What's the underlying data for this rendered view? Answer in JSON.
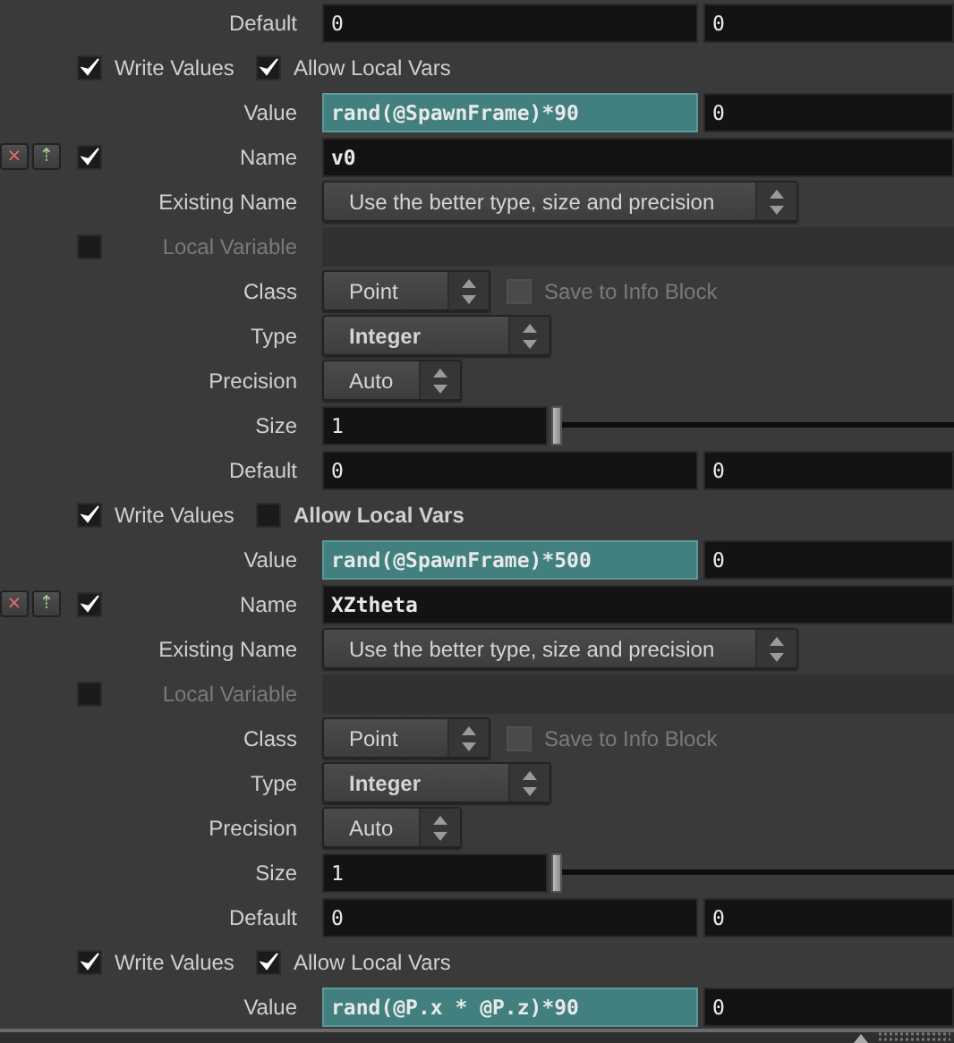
{
  "rows": [
    {
      "kind": "vector",
      "label": "Default",
      "expression": false,
      "values": [
        "0",
        "0"
      ]
    },
    {
      "kind": "checks",
      "items": [
        {
          "label": "Write Values",
          "checked": true,
          "modified": false
        },
        {
          "label": "Allow Local Vars",
          "checked": true,
          "modified": false
        }
      ]
    },
    {
      "kind": "vector",
      "label": "Value",
      "expression": true,
      "values": [
        "rand(@SpawnFrame)*90",
        "0"
      ]
    },
    {
      "kind": "name",
      "label": "Name",
      "enabled": true,
      "value": "v0",
      "remove": "×",
      "move": "⇡"
    },
    {
      "kind": "existing_menu",
      "label": "Existing Name",
      "value": "Use the better type, size and precision",
      "modified": false
    },
    {
      "kind": "local",
      "label": "Local Variable",
      "checked": false,
      "disabled": true
    },
    {
      "kind": "class_menu",
      "label": "Class",
      "value": "Point",
      "modified": false,
      "option": {
        "label": "Save to Info Block",
        "checked": false,
        "disabled": true
      }
    },
    {
      "kind": "type_menu",
      "label": "Type",
      "value": "Integer",
      "modified": true
    },
    {
      "kind": "precision_menu",
      "label": "Precision",
      "value": "Auto",
      "modified": false
    },
    {
      "kind": "slider",
      "label": "Size",
      "value": "1",
      "level": 0
    },
    {
      "kind": "vector",
      "label": "Default",
      "expression": false,
      "values": [
        "0",
        "0"
      ]
    },
    {
      "kind": "checks",
      "items": [
        {
          "label": "Write Values",
          "checked": true,
          "modified": false
        },
        {
          "label": "Allow Local Vars",
          "checked": false,
          "modified": true
        }
      ]
    },
    {
      "kind": "vector",
      "label": "Value",
      "expression": true,
      "values": [
        "rand(@SpawnFrame)*500",
        "0"
      ]
    },
    {
      "kind": "name",
      "label": "Name",
      "enabled": true,
      "value": "XZtheta",
      "remove": "×",
      "move": "⇡"
    },
    {
      "kind": "existing_menu",
      "label": "Existing Name",
      "value": "Use the better type, size and precision",
      "modified": false
    },
    {
      "kind": "local",
      "label": "Local Variable",
      "checked": false,
      "disabled": true
    },
    {
      "kind": "class_menu",
      "label": "Class",
      "value": "Point",
      "modified": false,
      "option": {
        "label": "Save to Info Block",
        "checked": false,
        "disabled": true
      }
    },
    {
      "kind": "type_menu",
      "label": "Type",
      "value": "Integer",
      "modified": true
    },
    {
      "kind": "precision_menu",
      "label": "Precision",
      "value": "Auto",
      "modified": false
    },
    {
      "kind": "slider",
      "label": "Size",
      "value": "1",
      "level": 0
    },
    {
      "kind": "vector",
      "label": "Default",
      "expression": false,
      "values": [
        "0",
        "0"
      ]
    },
    {
      "kind": "checks",
      "items": [
        {
          "label": "Write Values",
          "checked": true,
          "modified": false
        },
        {
          "label": "Allow Local Vars",
          "checked": true,
          "modified": false
        }
      ]
    },
    {
      "kind": "vector",
      "label": "Value",
      "expression": true,
      "values": [
        "rand(@P.x * @P.z)*90",
        "0"
      ]
    }
  ]
}
